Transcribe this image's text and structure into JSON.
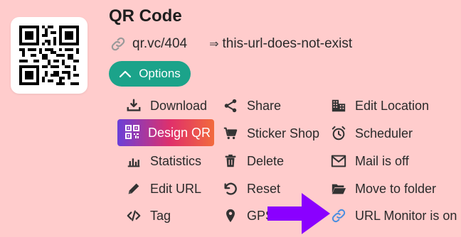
{
  "header": {
    "title": "QR Code",
    "short_url": "qr.vc/404",
    "arrow": "⇒",
    "target_url": "this-url-does-not-exist"
  },
  "options_button": {
    "label": "Options",
    "icon": "chevron-up-icon"
  },
  "menu": {
    "col1": [
      {
        "label": "Download",
        "icon": "download-icon"
      },
      {
        "label": "Design QR",
        "icon": "qr-icon",
        "highlighted": true
      },
      {
        "label": "Statistics",
        "icon": "bar-chart-icon"
      },
      {
        "label": "Edit URL",
        "icon": "pencil-icon"
      },
      {
        "label": "Tag",
        "icon": "code-icon"
      }
    ],
    "col2": [
      {
        "label": "Share",
        "icon": "share-icon"
      },
      {
        "label": "Sticker Shop",
        "icon": "cart-icon"
      },
      {
        "label": "Delete",
        "icon": "trash-icon"
      },
      {
        "label": "Reset",
        "icon": "undo-icon"
      },
      {
        "label": "GPS",
        "icon": "map-pin-icon"
      }
    ],
    "col3": [
      {
        "label": "Edit Location",
        "icon": "building-icon"
      },
      {
        "label": "Scheduler",
        "icon": "alarm-clock-icon"
      },
      {
        "label": "Mail is off",
        "icon": "envelope-icon"
      },
      {
        "label": "Move to folder",
        "icon": "folder-open-icon"
      },
      {
        "label": "URL Monitor is on",
        "icon": "link-icon"
      }
    ]
  },
  "colors": {
    "background": "#ffcccc",
    "options_button": "#1ba38a",
    "design_gradient": [
      "#6a3fd8",
      "#e0306a",
      "#f26a3c"
    ],
    "annotation_arrow": "#8a00ff",
    "monitor_link": "#4a8ee0"
  }
}
